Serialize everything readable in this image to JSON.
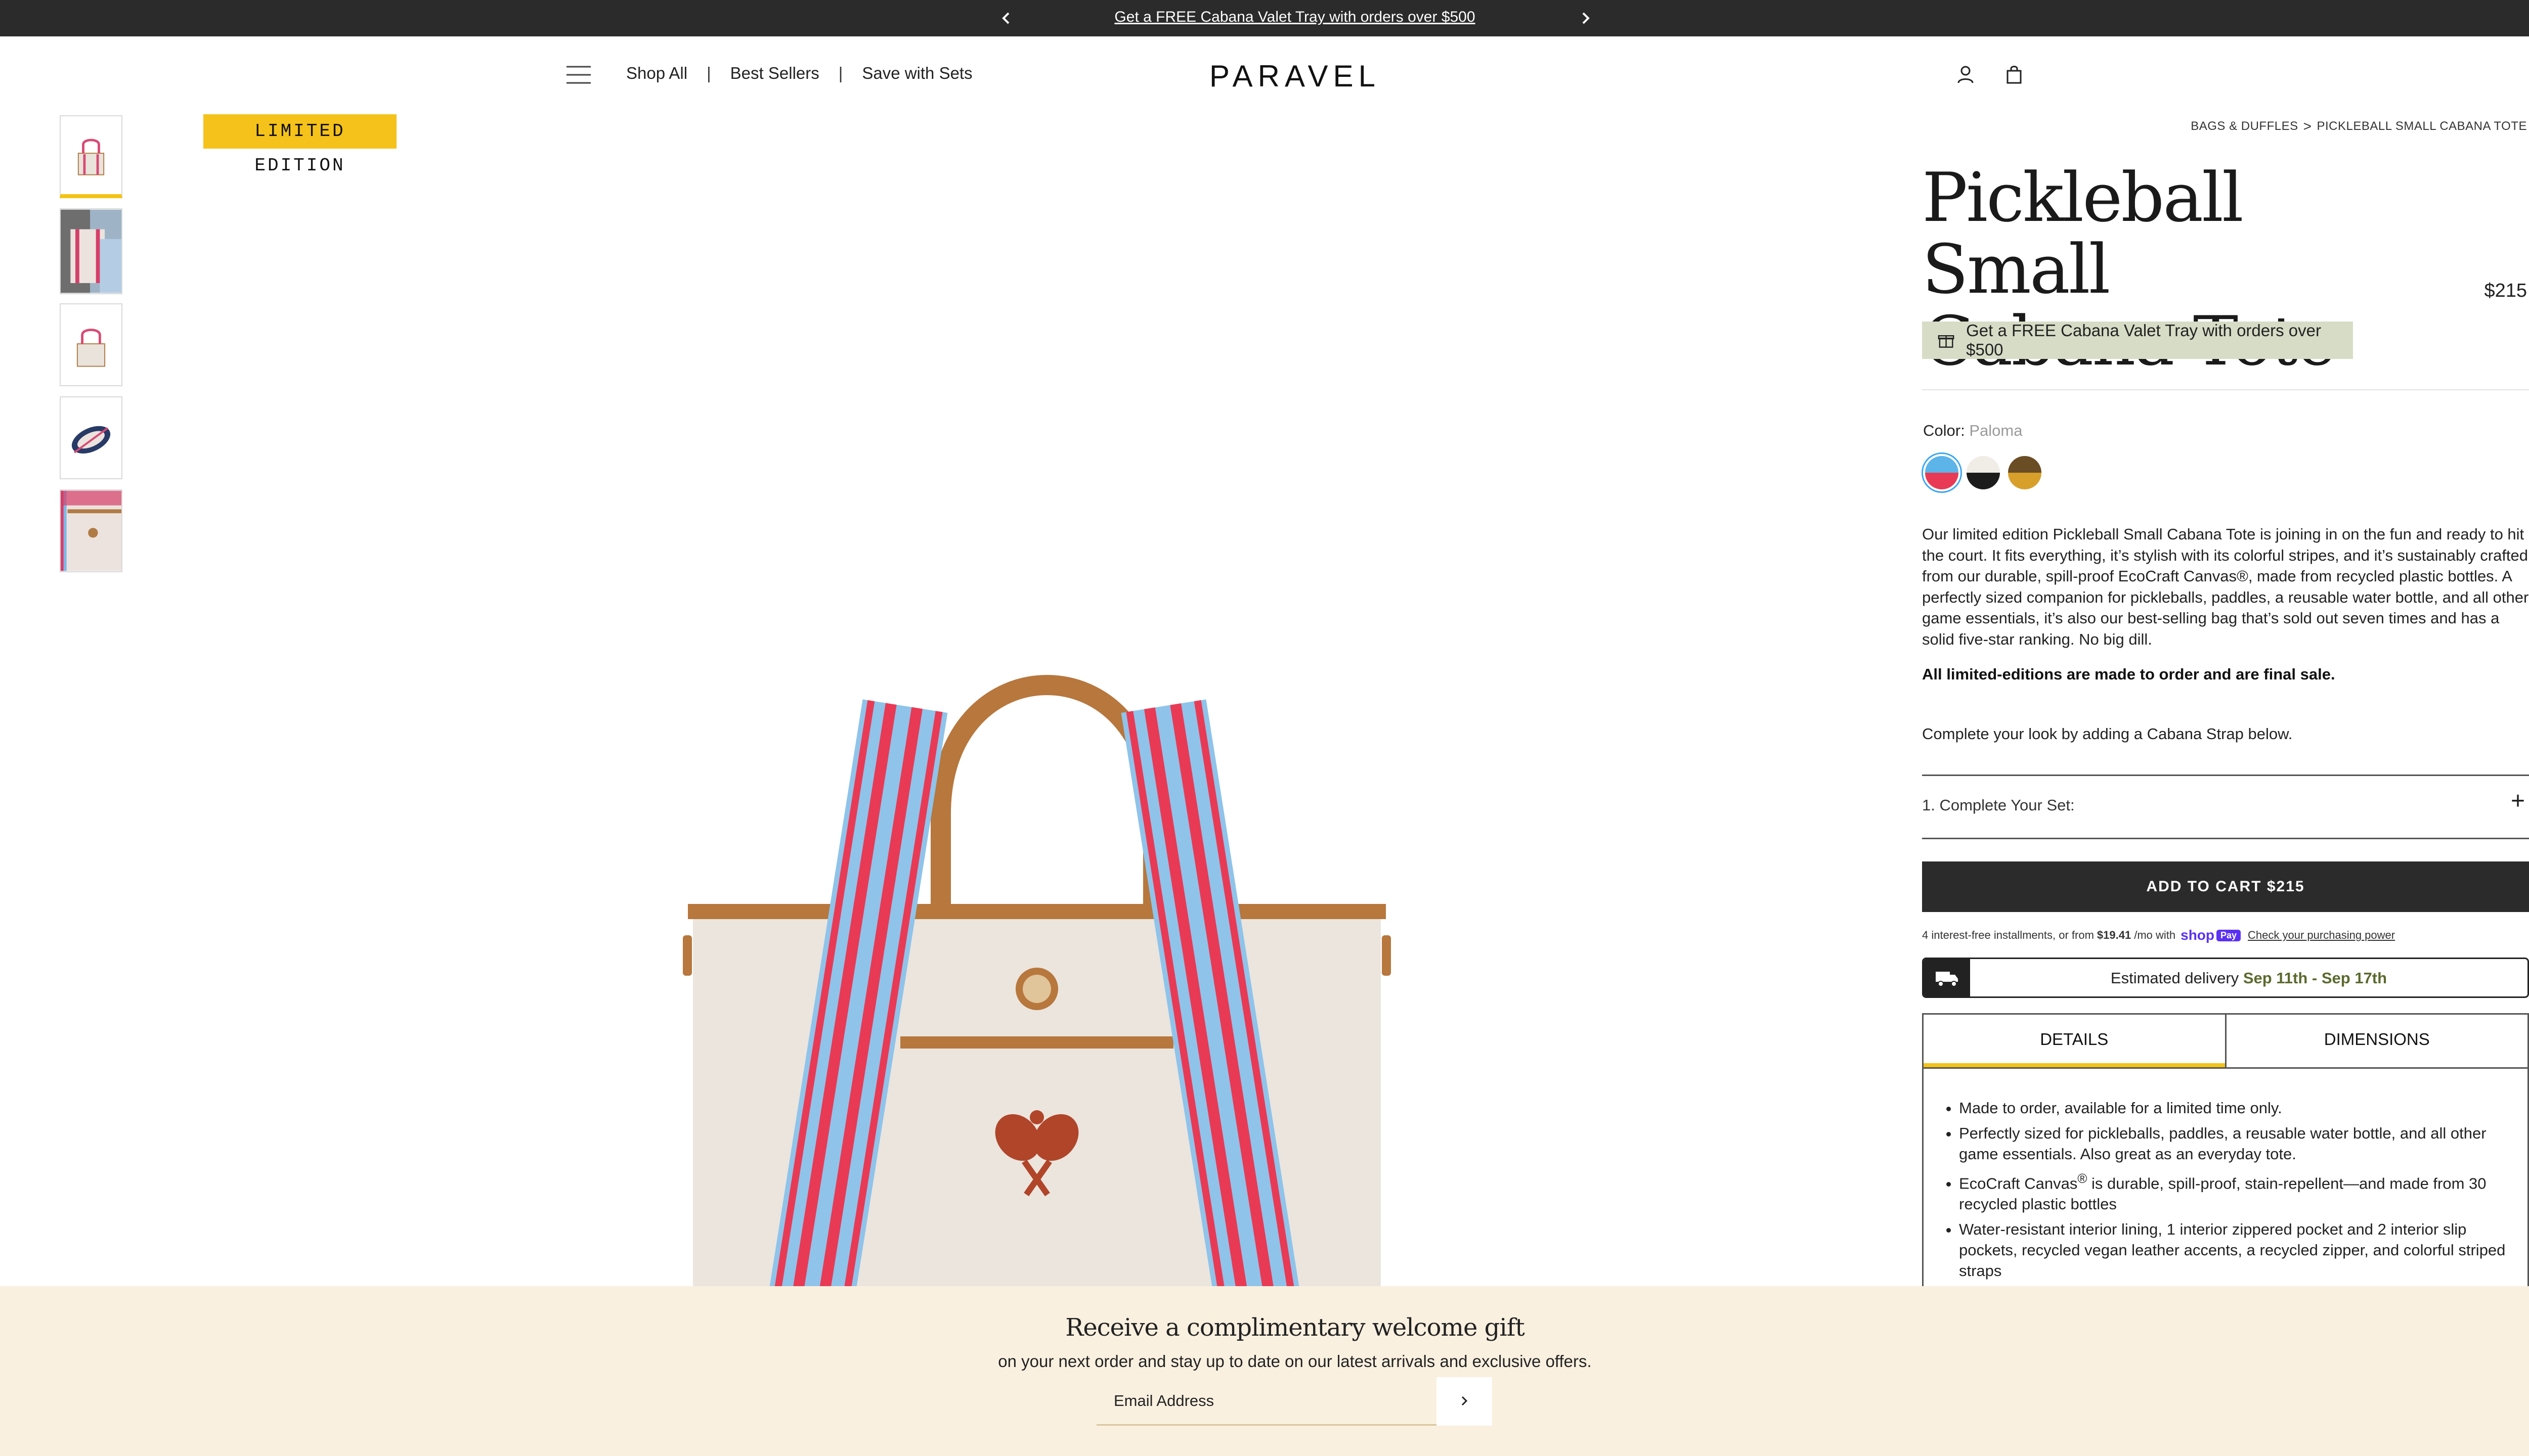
{
  "announcement": {
    "message": "Get a FREE Cabana Valet Tray with orders over $500",
    "prev_icon": "chevron-left-icon",
    "next_icon": "chevron-right-icon"
  },
  "header": {
    "logo": "PARAVEL",
    "nav": [
      {
        "label": "Shop All"
      },
      {
        "label": "Best Sellers"
      },
      {
        "label": "Save with Sets"
      }
    ],
    "nav_separator": "|",
    "icons": [
      "hamburger-menu-icon",
      "account-icon",
      "shopping-bag-icon"
    ]
  },
  "gallery": {
    "badge": "LIMITED EDITION",
    "thumbnails": [
      {
        "desc": "tote front"
      },
      {
        "desc": "tote in hand"
      },
      {
        "desc": "tote side"
      },
      {
        "desc": "tote interior"
      },
      {
        "desc": "tote detail"
      }
    ]
  },
  "product": {
    "breadcrumb": [
      "BAGS & DUFFLES",
      "PICKLEBALL SMALL CABANA TOTE"
    ],
    "breadcrumb_sep": ">",
    "title_line1": "Pickleball Small",
    "title_line2": "Cabana Tote",
    "price": "$215",
    "promo": "Get a FREE Cabana Valet Tray with orders over $500",
    "color_label": "Color:",
    "color_value": "Paloma",
    "swatches": [
      {
        "top": "#5cb4e8",
        "bottom": "#e83a55",
        "selected": true
      },
      {
        "top": "#f0ece6",
        "bottom": "#1c1c1c",
        "selected": false
      },
      {
        "top": "#6a4d25",
        "bottom": "#d8a02a",
        "selected": false
      }
    ],
    "description": "Our limited edition Pickleball Small Cabana Tote is joining in on the fun and ready to hit the court. It fits everything, it’s stylish with its colorful stripes, and it’s sustainably crafted from our durable, spill-proof EcoCraft Canvas®, made from recycled plastic bottles. A perfectly sized companion for pickleballs, paddles, a reusable water bottle, and all other game essentials, it’s also our best-selling bag that’s sold out seven times and has a solid five-star ranking. No big dill.",
    "final_sale": "All limited-editions are made to order and are final sale.",
    "complete_look": "Complete your look by adding a Cabana Strap below.",
    "accordion_label": "1. Complete Your Set:",
    "accordion_icon": "+",
    "add_to_cart": "ADD TO CART $215",
    "installments_prefix": "4 interest-free installments, or from",
    "installments_amount": "$19.41",
    "installments_suffix": "/mo with",
    "shop_pay_text": "shop",
    "shop_pay_badge": "Pay",
    "installments_link": "Check your purchasing power",
    "delivery_label": "Estimated delivery",
    "delivery_dates": "Sep 11th - Sep 17th",
    "tabs": [
      {
        "label": "DETAILS",
        "active": true
      },
      {
        "label": "DIMENSIONS",
        "active": false
      }
    ],
    "details": [
      {
        "text": "Made to order, available for a limited time only."
      },
      {
        "text": "Perfectly sized for pickleballs, paddles, a reusable water bottle, and all other game essentials. Also great as an everyday tote."
      },
      {
        "text_before": "EcoCraft Canvas",
        "sup": "®",
        "text_after": " is durable, spill-proof, stain-repellent—and made from 30 recycled plastic bottles"
      },
      {
        "text": "Water-resistant interior lining, 1 interior zippered pocket and 2 interior slip pockets, recycled vegan leather accents, a recycled zipper, and colorful striped straps"
      }
    ]
  },
  "newsletter": {
    "title": "Receive a complimentary welcome gift",
    "subtitle": "on your next order and stay up to date on our latest arrivals and exclusive offers.",
    "email_placeholder": "Email Address",
    "close_icon": "close-icon"
  },
  "colors": {
    "badge": "#f5c21b",
    "promo_bg": "#d7dcc6",
    "button_dark": "#2b2b2b",
    "newsletter_bg": "#faf0e0",
    "delivery_date": "#5b6a2e"
  }
}
